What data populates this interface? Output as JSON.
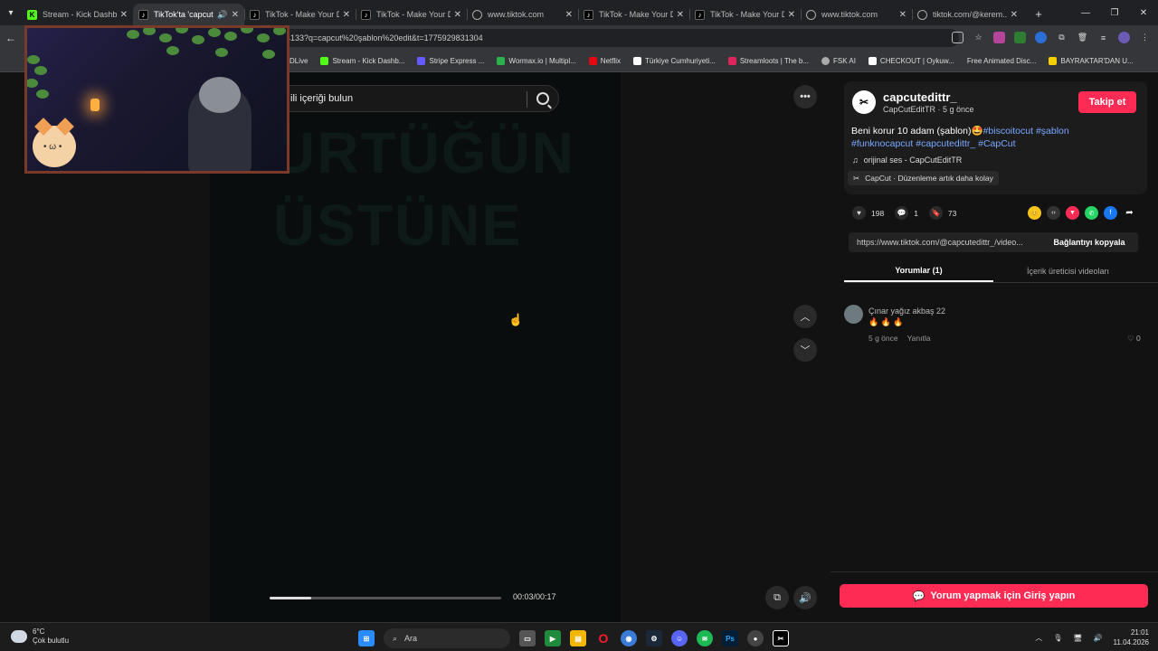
{
  "browser": {
    "tabs": [
      {
        "title": "Stream - Kick Dashboard",
        "icon": "kick-icon",
        "active": false
      },
      {
        "title": "TikTok'ta 'capcut şablon'",
        "icon": "tiktok-icon",
        "active": true
      },
      {
        "title": "TikTok - Make Your Day",
        "icon": "tiktok-icon",
        "active": false
      },
      {
        "title": "TikTok - Make Your Day",
        "icon": "tiktok-icon",
        "active": false
      },
      {
        "title": "www.tiktok.com",
        "icon": "globe-icon",
        "active": false
      },
      {
        "title": "TikTok - Make Your Day",
        "icon": "tiktok-icon",
        "active": false
      },
      {
        "title": "TikTok - Make Your Day",
        "icon": "tiktok-icon",
        "active": false
      },
      {
        "title": "www.tiktok.com",
        "icon": "globe-icon",
        "active": false
      },
      {
        "title": "tiktok.com/@kerem...",
        "icon": "globe-icon",
        "active": false
      }
    ],
    "url": "4133?q=capcut%20şablon%20edit&t=1775929831304",
    "bookmarks": [
      {
        "label": "DLive",
        "color": "#f5c518"
      },
      {
        "label": "Stream - Kick Dashb...",
        "color": "#53fc18"
      },
      {
        "label": "Stripe Express ...",
        "color": "#635bff"
      },
      {
        "label": "Wormax.io | Multipl...",
        "color": "#2bb24c"
      },
      {
        "label": "Netflix",
        "color": "#e50914"
      },
      {
        "label": "Türkiye Cumhuriyeti...",
        "color": "#ffffff"
      },
      {
        "label": "Streamloots | The b...",
        "color": "#e0245e"
      },
      {
        "label": "FSK AI",
        "color": "#aaaaaa"
      },
      {
        "label": "CHECKOUT | Oykuw...",
        "color": "#ffffff"
      },
      {
        "label": "Free Animated Disc...",
        "color": "#5865f2"
      },
      {
        "label": "BAYRAKTAR'DAN U...",
        "color": "#f5d000"
      }
    ]
  },
  "search": {
    "placeholder": "ili içeriği bulun"
  },
  "video": {
    "overlay_line1": "URTÜĞÜN",
    "overlay_line2": "ÜSTÜNE",
    "time": "00:03/00:17",
    "progress": 0.18
  },
  "post": {
    "username": "capcutedittr_",
    "nickname": "CapCutEditTR · 5 g önce",
    "follow_label": "Takip et",
    "description_text": "Beni korur 10 adam (şablon)🤩",
    "hashtags": [
      "#biscoitocut",
      "#şablon",
      "#funknocapcut",
      "#capcutedittr_",
      "#CapCut"
    ],
    "sound": "orijinal ses - CapCutEditTR",
    "capcut_label": "CapCut · Düzenleme artık daha kolay",
    "likes": "198",
    "comments": "1",
    "saves": "73",
    "link": "https://www.tiktok.com/@capcutedittr_/video...",
    "copy_link_label": "Bağlantıyı kopyala",
    "tab_comments": "Yorumlar (1)",
    "tab_creator": "İçerik üreticisi videoları"
  },
  "comment": {
    "user": "Çınar yağız akbaş 22",
    "text": "🔥 🔥 🔥",
    "time": "5 g önce",
    "reply_label": "Yanıtla",
    "likes": "0"
  },
  "login_label": "Yorum yapmak için Giriş yapın",
  "taskbar": {
    "temperature": "6°C",
    "weather": "Çok bulutlu",
    "search_label": "Ara",
    "time": "21:01",
    "date": "11.04.2026"
  }
}
